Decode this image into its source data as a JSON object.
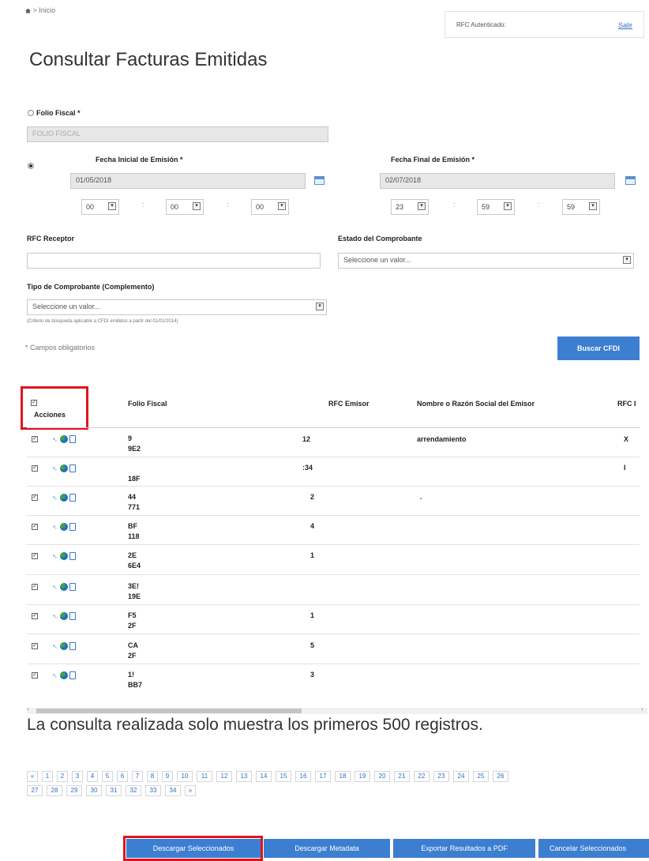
{
  "breadcrumb": {
    "home_icon": "home-icon",
    "separator": ">",
    "current": "Inicio"
  },
  "auth": {
    "label": "RFC Autenticado:",
    "logout": "Salir"
  },
  "page_title": "Consultar Facturas Emitidas",
  "form": {
    "folio_label": "Folio Fiscal *",
    "folio_placeholder": "FOLIO FISCAL",
    "fecha_inicial_label": "Fecha Inicial de Emisión *",
    "fecha_inicial_value": "01/05/2018",
    "fecha_final_label": "Fecha Final de Emisión *",
    "fecha_final_value": "02/07/2018",
    "hora_inicial": {
      "hh": "00",
      "mm": "00",
      "ss": "00"
    },
    "hora_final": {
      "hh": "23",
      "mm": "59",
      "ss": "59"
    },
    "time_sep": ":",
    "rfc_receptor_label": "RFC Receptor",
    "rfc_receptor_value": "",
    "estado_label": "Estado del Comprobante",
    "estado_value": "Seleccione un valor...",
    "tipo_label": "Tipo de Comprobante (Complemento)",
    "tipo_value": "Seleccione un valor...",
    "tipo_note": "(Criterio de búsqueda aplicable a CFDI emitidos a partir del 01/01/2014)",
    "required_note": "* Campos obligatorios",
    "search_button": "Buscar CFDI"
  },
  "table": {
    "headers": [
      "Acciones",
      "Folio Fiscal",
      "RFC Emisor",
      "Nombre o Razón Social del Emisor",
      "RFC I"
    ],
    "rows": [
      {
        "folio_1": "9",
        "folio_2": "9E2",
        "rfc": "12",
        "nombre": "arrendamiento",
        "extra": "X"
      },
      {
        "folio_1": "",
        "folio_2": "18F",
        "rfc": ":34",
        "nombre": "",
        "extra": "I"
      },
      {
        "folio_1": "44",
        "folio_2": "771",
        "rfc": "2",
        "nombre": ".",
        "extra": ""
      },
      {
        "folio_1": "BF",
        "folio_2": "118",
        "rfc": "4",
        "nombre": "",
        "extra": ""
      },
      {
        "folio_1": "2E",
        "folio_2": "6E4",
        "rfc": "1",
        "nombre": "",
        "extra": ""
      },
      {
        "folio_1": "3E!",
        "folio_2": "19E",
        "rfc": "",
        "nombre": "",
        "extra": ""
      },
      {
        "folio_1": "F5",
        "folio_2": "2F",
        "rfc": "1",
        "nombre": "",
        "extra": ""
      },
      {
        "folio_1": "CA",
        "folio_2": "2F",
        "rfc": "5",
        "nombre": "",
        "extra": ""
      },
      {
        "folio_1": "1!",
        "folio_2": "BB7",
        "rfc": "3",
        "nombre": "",
        "extra": ""
      }
    ]
  },
  "limit_message": "La consulta realizada solo muestra los primeros 500 registros.",
  "pagination": {
    "prev": "«",
    "next": "»",
    "pages": [
      "1",
      "2",
      "3",
      "4",
      "5",
      "6",
      "7",
      "8",
      "9",
      "10",
      "11",
      "12",
      "13",
      "14",
      "15",
      "16",
      "17",
      "18",
      "19",
      "20",
      "21",
      "22",
      "23",
      "24",
      "25",
      "26",
      "27",
      "28",
      "29",
      "30",
      "31",
      "32",
      "33",
      "34"
    ]
  },
  "actions": {
    "download_selected": "Descargar Seleccionados",
    "download_metadata": "Descargar Metadata",
    "export_pdf": "Exportar Resultados a PDF",
    "cancel_selected": "Cancelar Seleccionados"
  },
  "colors": {
    "accent": "#3c7fd1",
    "highlight": "#e0141e"
  }
}
